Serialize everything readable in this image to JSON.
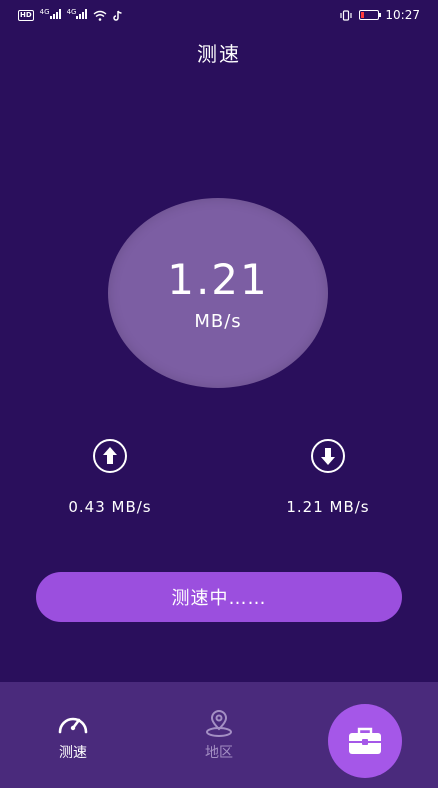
{
  "status_bar": {
    "left_badge": "HD",
    "net1": "4G",
    "net2": "4G",
    "time": "10:27"
  },
  "page": {
    "title": "测速"
  },
  "gauge": {
    "value": "1.21",
    "unit": "MB/s"
  },
  "upload": {
    "value": "0.43 MB/s",
    "icon": "upload-arrow-icon"
  },
  "download": {
    "value": "1.21 MB/s",
    "icon": "download-arrow-icon"
  },
  "action_button": {
    "label": "测速中……"
  },
  "bottom_nav": {
    "items": [
      {
        "label": "测速",
        "icon": "speedometer-icon",
        "active": true
      },
      {
        "label": "地区",
        "icon": "location-pin-icon",
        "active": false
      }
    ],
    "fab_icon": "toolbox-icon"
  },
  "colors": {
    "background": "#2a0f5c",
    "gauge": "#7c5ea3",
    "button": "#9b4fde",
    "nav_bar": "#4a2a7c",
    "fab": "#a557e8",
    "inactive": "#a48fc4"
  }
}
